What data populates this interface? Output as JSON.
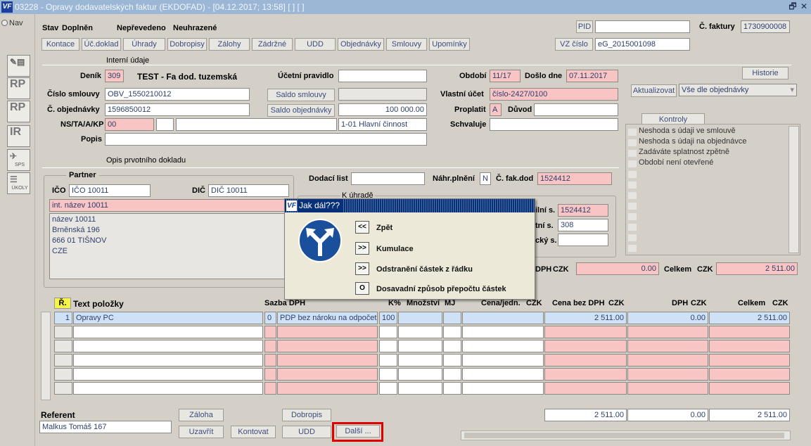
{
  "window": {
    "title": "03228 - Opravy dodavatelských faktur (EKDOFAD) - [04.12.2017; 13:58]  [ ]  [ ]",
    "restore": "🗗",
    "close": "✕"
  },
  "nav": {
    "label": "Nav"
  },
  "side": {
    "rp1": "RP",
    "rp2": "RP",
    "ir": "IR",
    "sps": "SPS",
    "ukoly": "ÚKOLY"
  },
  "status": {
    "stav_label": "Stav",
    "stav": "Doplněn",
    "neprevedeno": "Nepřevedeno",
    "neuhrazene": "Neuhrazené"
  },
  "pid_label": "PID",
  "pid": "",
  "cfaktury_label": "Č. faktury",
  "cfaktury": "1730900008",
  "vz_btn": "VZ číslo",
  "vz": "eG_2015001098",
  "topbuttons": [
    "Kontace",
    "Úč.doklad",
    "Úhrady",
    "Dobropisy",
    "Zálohy",
    "Zádržné",
    "UDD",
    "Objednávky",
    "Smlouvy",
    "Upomínky"
  ],
  "interni_udaje": "Interní údaje",
  "denik_label": "Deník",
  "denik": "309",
  "denik_text": "TEST - Fa dod. tuzemská",
  "ucetni_pravidlo_label": "Účetní pravidlo",
  "ucetni_pravidlo": "",
  "obdobi_label": "Období",
  "obdobi": "11/17",
  "doslo_label": "Došlo dne",
  "doslo": "07.11.2017",
  "historie": "Historie",
  "cislo_smlouvy_label": "Číslo smlouvy",
  "cislo_smlouvy": "OBV_1550210012",
  "saldo_smlouvy": "Saldo smlouvy",
  "saldo_smlouvy_val": "",
  "vlastni_ucet_label": "Vlastní účet",
  "vlastni_ucet": "číslo-2427/0100",
  "aktualizovat": "Aktualizovat",
  "vse_dle": "Vše dle objednávky",
  "c_objednavky_label": "Č. objednávky",
  "c_objednavky": "1596850012",
  "saldo_obj": "Saldo objednávky",
  "saldo_obj_val": "100 000.00",
  "proplatit_label": "Proplatit",
  "proplatit": "A",
  "duvod_label": "Důvod",
  "duvod": "",
  "nstaakp_label": "NS/TA/A/KP",
  "nstaakp": "00",
  "nsta2": "",
  "nsta3": "",
  "nsta4": "1-01 Hlavní činnost",
  "schvaluje_label": "Schvaluje",
  "schvaluje": "",
  "popis_label": "Popis",
  "popis": "",
  "kontroly": {
    "label": "Kontroly",
    "items": [
      "Neshoda s údaji ve smlouvě",
      "Neshoda s údaji na objednávce",
      "Zadáváte splatnost zpětně",
      "Období není otevřené"
    ]
  },
  "opis": "Opis prvotního dokladu",
  "partner": {
    "label": "Partner",
    "ico_label": "IČO",
    "ico": "IČO 10011",
    "dic_label": "DIČ",
    "dic": "DIČ 10011",
    "int_nazev": "int. název 10011",
    "address": [
      "název 10011",
      "Brněnská 196",
      "666 01 TIŠNOV",
      "CZE"
    ]
  },
  "dodaci_label": "Dodací list",
  "dodaci": "",
  "nahr_label": "Náhr.plnění",
  "nahr": "N",
  "cfakdod_label": "Č. fak.dod",
  "cfakdod": "1524412",
  "kuhrade": "K úhradě",
  "vs_label": "ilní s.",
  "vs": "1524412",
  "ks_label": "tní s.",
  "ks": "308",
  "ss_label": "cký s.",
  "ss": "",
  "dph_label": "DPH",
  "czk": "CZK",
  "dph_val": "0.00",
  "celkem_label": "Celkem",
  "celkem_val": "2 511.00",
  "grid": {
    "r": "Ř.",
    "text": "Text položky",
    "sazba": "Sazba DPH",
    "k": "K%",
    "mnozstvi": "Množství",
    "mj": "MJ",
    "cena_jedn": "Cena/jedn.",
    "cena_bez": "Cena bez DPH",
    "dph": "DPH",
    "celkem": "Celkem",
    "czk": "CZK",
    "row1": {
      "n": "1",
      "text": "Opravy PC",
      "sazba": "0",
      "sazba_text": "PDP bez nároku na odpočet",
      "k": "100",
      "cena_bez": "2 511.00",
      "dph": "0.00",
      "celkem": "2 511.00"
    }
  },
  "totals": {
    "cena_bez": "2 511.00",
    "dph": "0.00",
    "celkem": "2 511.00"
  },
  "referent_label": "Referent",
  "referent": "Malkus Tomáš 167",
  "bottom": {
    "zaloha": "Záloha",
    "dobropis": "Dobropis",
    "uzavrit": "Uzavřít",
    "kontovat": "Kontovat",
    "udd": "UDD",
    "dalsi": "Další ..."
  },
  "dialog": {
    "title": "Jak dál???",
    "options": [
      {
        "key": "<<",
        "label": "Zpět"
      },
      {
        "key": ">>",
        "label": "Kumulace"
      },
      {
        "key": ">>",
        "label": "Odstranění částek z řádku"
      },
      {
        "key": "O",
        "label": "Dosavadní způsob přepočtu částek"
      }
    ]
  }
}
